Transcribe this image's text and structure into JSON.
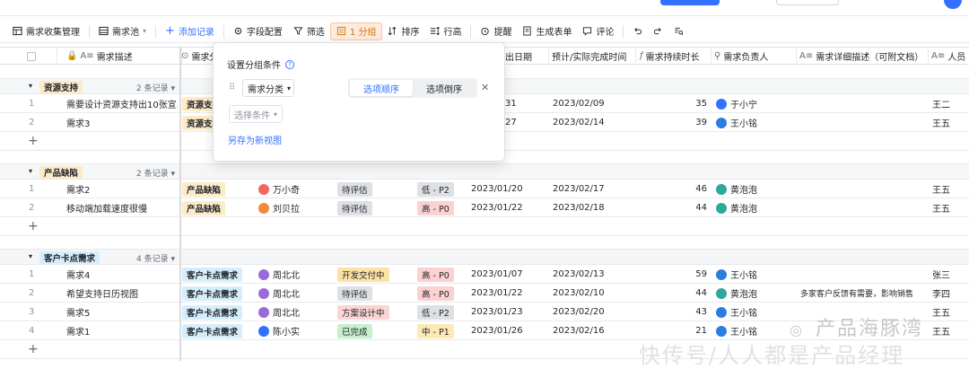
{
  "toolbar": {
    "table_name": "需求收集管理",
    "view_name": "需求池",
    "add_record": "添加记录",
    "field_config": "字段配置",
    "filter": "筛选",
    "group": "1 分组",
    "sort": "排序",
    "row_height": "行高",
    "reminder": "提醒",
    "gen_form": "生成表单",
    "comment": "评论"
  },
  "columns": {
    "desc": "需求描述",
    "category": "需求分",
    "date_start": "出日期",
    "date_done": "预计/实际完成时间",
    "duration": "需求持续时长",
    "owner": "需求负责人",
    "detail": "需求详细描述（可附文档）",
    "person": "人员"
  },
  "popup": {
    "title": "设置分组条件",
    "field": "需求分类",
    "asc": "选项顺序",
    "desc": "选项倒序",
    "select_placeholder": "选择条件",
    "save_view": "另存为新视图"
  },
  "groups": [
    {
      "name": "资源支持",
      "count": "2 条记录",
      "color": "#fdebc8",
      "rows": [
        {
          "idx": "1",
          "desc": "需要设计资源支持出10张宣...",
          "cat": "资源支持",
          "c_pri": "",
          "status": "",
          "priority": "",
          "date_start": "31",
          "date_done": "2023/02/09",
          "duration": "35",
          "owner": "于小宁",
          "owner_color": "#3370ff",
          "detail": "",
          "person": "王二"
        },
        {
          "idx": "2",
          "desc": "需求3",
          "cat": "资源支持",
          "c_pri": "",
          "status": "",
          "priority": "",
          "date_start": "27",
          "date_done": "2023/02/14",
          "duration": "39",
          "owner": "王小铭",
          "owner_color": "#2a7de1",
          "detail": "",
          "person": "王五"
        }
      ]
    },
    {
      "name": "产品缺陷",
      "count": "2 条记录",
      "color": "#fdebc8",
      "rows": [
        {
          "idx": "1",
          "desc": "需求2",
          "cat": "产品缺陷",
          "creator": "万小奇",
          "creator_color": "#f76560",
          "status": "待评估",
          "priority": "低 - P2",
          "date_start": "2023/01/20",
          "date_done": "2023/02/17",
          "duration": "46",
          "owner": "黄泡泡",
          "owner_color": "#2ea89a",
          "detail": "",
          "person": "王五"
        },
        {
          "idx": "2",
          "desc": "移动端加载速度很慢",
          "cat": "产品缺陷",
          "creator": "刘贝拉",
          "creator_color": "#f08a3c",
          "status": "待评估",
          "priority": "高 - P0",
          "date_start": "2023/01/22",
          "date_done": "2023/02/18",
          "duration": "44",
          "owner": "黄泡泡",
          "owner_color": "#2ea89a",
          "detail": "",
          "person": "王五"
        }
      ]
    },
    {
      "name": "客户卡点需求",
      "count": "4 条记录",
      "color": "#d6eefc",
      "rows": [
        {
          "idx": "1",
          "desc": "需求4",
          "cat": "客户卡点需求",
          "creator": "周北北",
          "creator_color": "#9a6ad8",
          "status": "开发交付中",
          "priority": "高 - P0",
          "date_start": "2023/01/07",
          "date_done": "2023/02/13",
          "duration": "59",
          "owner": "王小铭",
          "owner_color": "#2a7de1",
          "detail": "",
          "person": "张三"
        },
        {
          "idx": "2",
          "desc": "希望支持日历视图",
          "cat": "客户卡点需求",
          "creator": "周北北",
          "creator_color": "#9a6ad8",
          "status": "待评估",
          "priority": "高 - P0",
          "date_start": "2023/01/22",
          "date_done": "2023/02/10",
          "duration": "44",
          "owner": "黄泡泡",
          "owner_color": "#2ea89a",
          "detail": "多家客户反馈有需要，影响销售",
          "person": "李四"
        },
        {
          "idx": "3",
          "desc": "需求5",
          "cat": "客户卡点需求",
          "creator": "周北北",
          "creator_color": "#9a6ad8",
          "status": "方案设计中",
          "priority": "低 - P2",
          "date_start": "2023/01/23",
          "date_done": "2023/02/20",
          "duration": "43",
          "owner": "王小铭",
          "owner_color": "#2a7de1",
          "detail": "",
          "person": "王五"
        },
        {
          "idx": "4",
          "desc": "需求1",
          "cat": "客户卡点需求",
          "creator": "陈小实",
          "creator_color": "#3370ff",
          "status": "已完成",
          "priority": "中 - P1",
          "date_start": "2023/01/26",
          "date_done": "2023/02/16",
          "duration": "21",
          "owner": "王小铭",
          "owner_color": "#2a7de1",
          "detail": "",
          "person": "王五"
        }
      ]
    }
  ],
  "watermark": {
    "line1": "产品海豚湾",
    "line2": "快传号/人人都是产品经理"
  }
}
